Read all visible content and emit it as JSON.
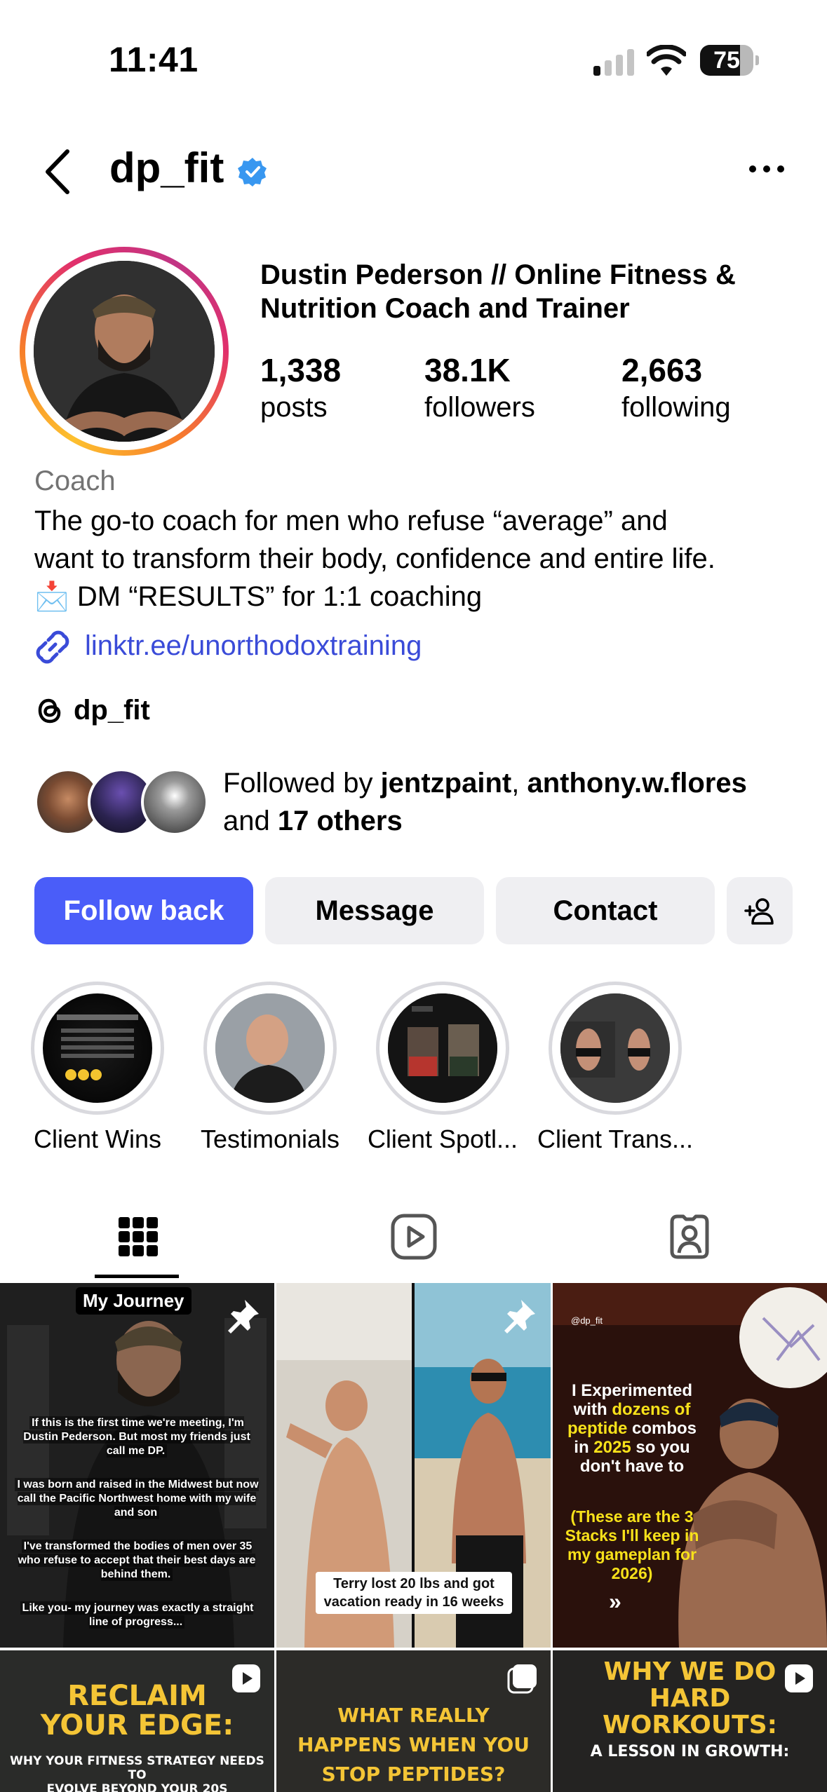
{
  "status_bar": {
    "time": "11:41",
    "battery": "75",
    "battery_level": 0.75
  },
  "header": {
    "username": "dp_fit"
  },
  "profile": {
    "full_name": "Dustin Pederson // Online Fitness & Nutrition Coach and Trainer",
    "stats": [
      {
        "value": "1,338",
        "label": "posts"
      },
      {
        "value": "38.1K",
        "label": "followers"
      },
      {
        "value": "2,663",
        "label": "following"
      }
    ],
    "category": "Coach",
    "bio_line1": "The go-to coach for men who refuse “average” and",
    "bio_line2": "want to transform their body, confidence and entire life.",
    "bio_line3": "📩 DM “RESULTS” for 1:1 coaching",
    "link": "linktr.ee/unorthodoxtraining",
    "threads_handle": "dp_fit",
    "followed_by": {
      "prefix": "Followed by ",
      "user1": "jentzpaint",
      "sep": ", ",
      "user2": "anthony.w.flores",
      "and": "and ",
      "others": "17 others"
    }
  },
  "buttons": {
    "follow_back": "Follow back",
    "message": "Message",
    "contact": "Contact"
  },
  "highlights": [
    {
      "label": "Client Wins"
    },
    {
      "label": "Testimonials"
    },
    {
      "label": "Client Spotl..."
    },
    {
      "label": "Client Trans..."
    }
  ],
  "grid": {
    "post1": {
      "tag": "My Journey",
      "lines": [
        "If this is the first time we're meeting, I'm Dustin Pederson. But most my friends just call me DP.",
        "I was born and raised in the Midwest but now call the Pacific Northwest home with my wife and son",
        "I've transformed the bodies of men over 35 who refuse to accept that their best days are behind them.",
        "Like you- my journey was exactly a straight line of progress..."
      ]
    },
    "post2": {
      "caption": "Terry lost 20 lbs and got vacation ready in 16 weeks"
    },
    "post3": {
      "handle": "@dp_fit",
      "h1": "I Experimented with ",
      "h2": "dozens of peptide",
      "h3": " combos in ",
      "h4": "2025",
      "h5": " so you don't have to",
      "sub": "(These are the 3 Stacks I'll keep in my gameplan for 2026)",
      "arrows": "»"
    },
    "post4": {
      "title1": "RECLAIM",
      "title2": "YOUR EDGE:",
      "sub1": "WHY YOUR FITNESS STRATEGY NEEDS TO",
      "sub2": "EVOLVE BEYOND YOUR 20S"
    },
    "post5": {
      "t1": "WHAT REALLY",
      "t2": "HAPPENS WHEN YOU",
      "t3": "STOP PEPTIDES?"
    },
    "post6": {
      "t1": "WHY WE DO",
      "t2": "HARD",
      "t3": "WORKOUTS:",
      "sub": "A LESSON IN GROWTH:"
    }
  },
  "colors": {
    "primary_button": "#4a5df9",
    "link": "#3a4bd8",
    "secondary_button": "#efeff2",
    "accent_yellow": "#f4c536"
  }
}
